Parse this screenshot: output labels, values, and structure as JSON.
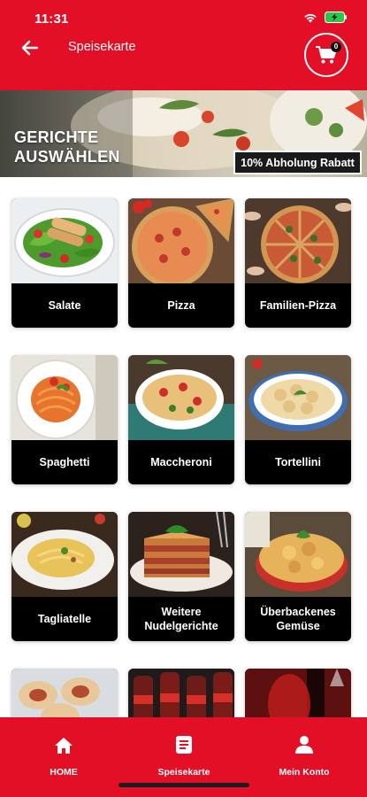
{
  "status_bar": {
    "time": "11:31"
  },
  "header": {
    "title": "Speisekarte",
    "cart_count": "0"
  },
  "banner": {
    "title": "GERICHTE\nAUSWÄHLEN",
    "badge": "10% Abholung Rabatt"
  },
  "categories": [
    {
      "label": "Salate",
      "icon": "salad-image"
    },
    {
      "label": "Pizza",
      "icon": "pizza-image"
    },
    {
      "label": "Familien-Pizza",
      "icon": "family-pizza-image"
    },
    {
      "label": "Spaghetti",
      "icon": "spaghetti-image"
    },
    {
      "label": "Maccheroni",
      "icon": "maccheroni-image"
    },
    {
      "label": "Tortellini",
      "icon": "tortellini-image"
    },
    {
      "label": "Tagliatelle",
      "icon": "tagliatelle-image"
    },
    {
      "label": "Weitere\nNudelgerichte",
      "icon": "lasagne-image"
    },
    {
      "label": "Überbackenes\nGemüse",
      "icon": "gratin-image"
    },
    {
      "label": "",
      "icon": "rolls-image"
    },
    {
      "label": "",
      "icon": "cola-image"
    },
    {
      "label": "",
      "icon": "wine-image"
    }
  ],
  "bottom_nav": {
    "home": "HOME",
    "menu": "Speisekarte",
    "account": "Mein Konto"
  },
  "colors": {
    "brand_red": "#e30f26",
    "card_label_bg": "#000000"
  }
}
